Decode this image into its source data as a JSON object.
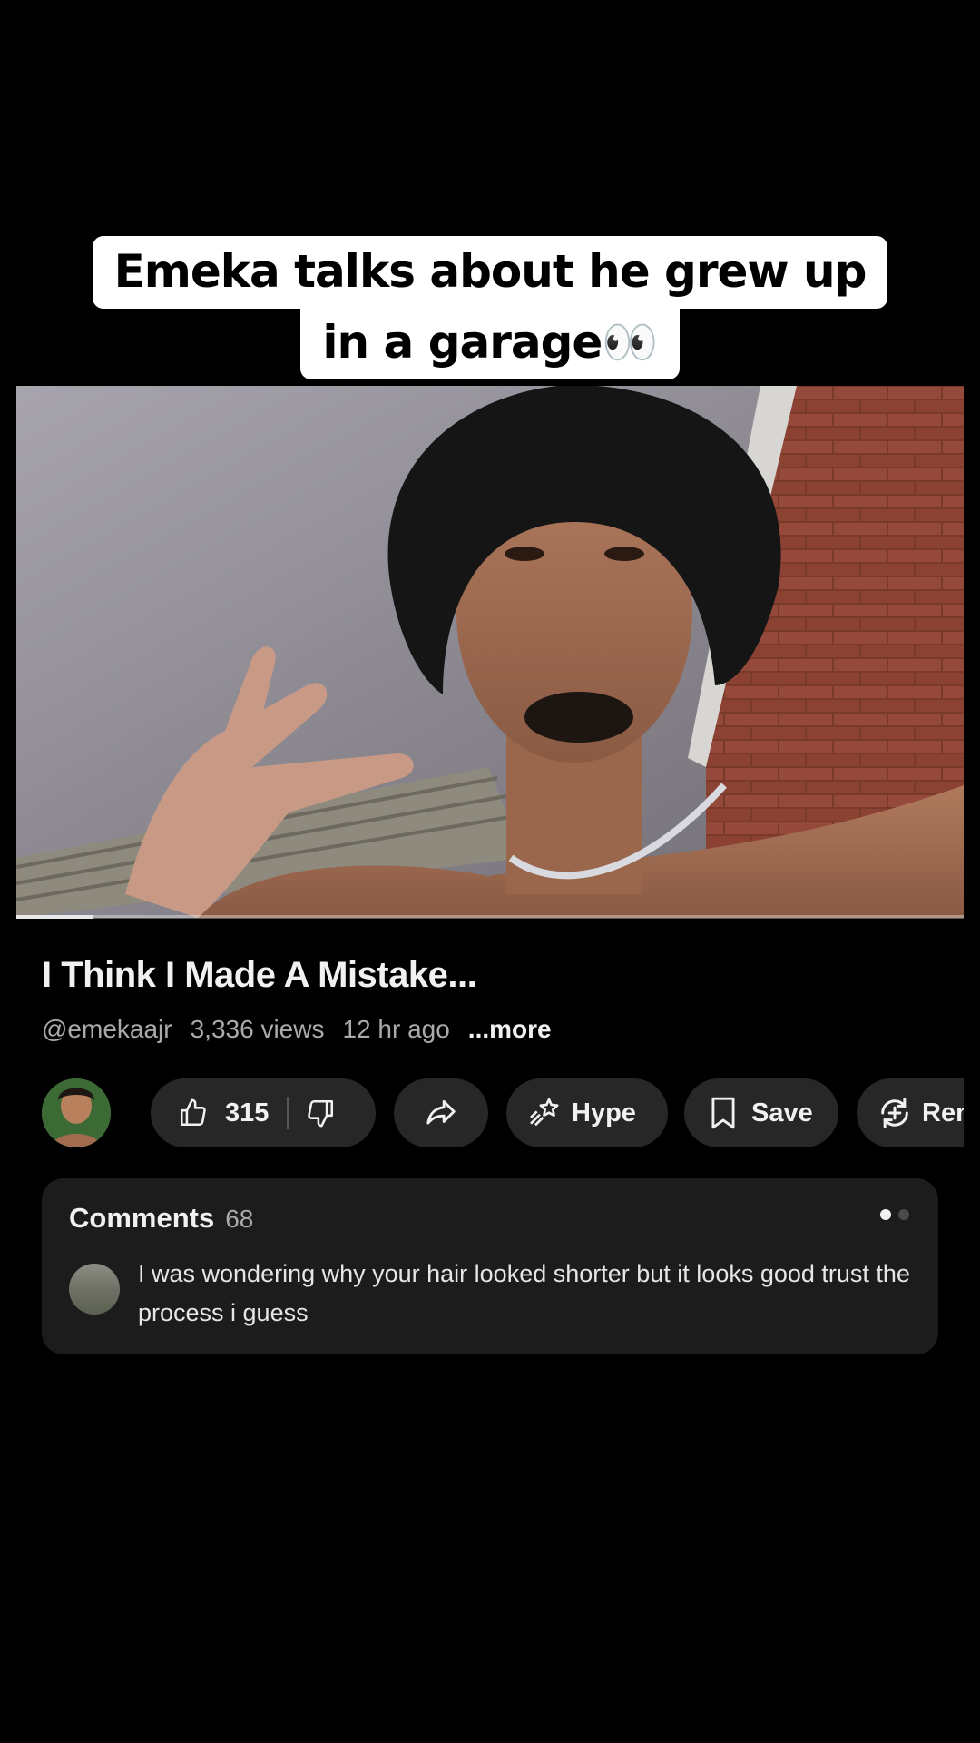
{
  "caption": {
    "line1": "Emeka talks about he grew up",
    "line2": "in a garage👀"
  },
  "video": {
    "progress_fraction": 0.08
  },
  "title": "I Think I Made A Mistake...",
  "meta": {
    "handle": "@emekaajr",
    "views": "3,336 views",
    "age": "12 hr ago",
    "more": "...more"
  },
  "actions": {
    "like_count": "315",
    "hype_label": "Hype",
    "save_label": "Save",
    "remix_label": "Remix"
  },
  "comments": {
    "title": "Comments",
    "count": "68",
    "top_comment": "I was wondering why your hair looked shorter but it looks good trust the process i guess"
  },
  "icons": {
    "like": "thumbs-up-icon",
    "dislike": "thumbs-down-icon",
    "share": "share-icon",
    "hype": "hype-icon",
    "save": "bookmark-icon",
    "remix": "remix-icon"
  }
}
